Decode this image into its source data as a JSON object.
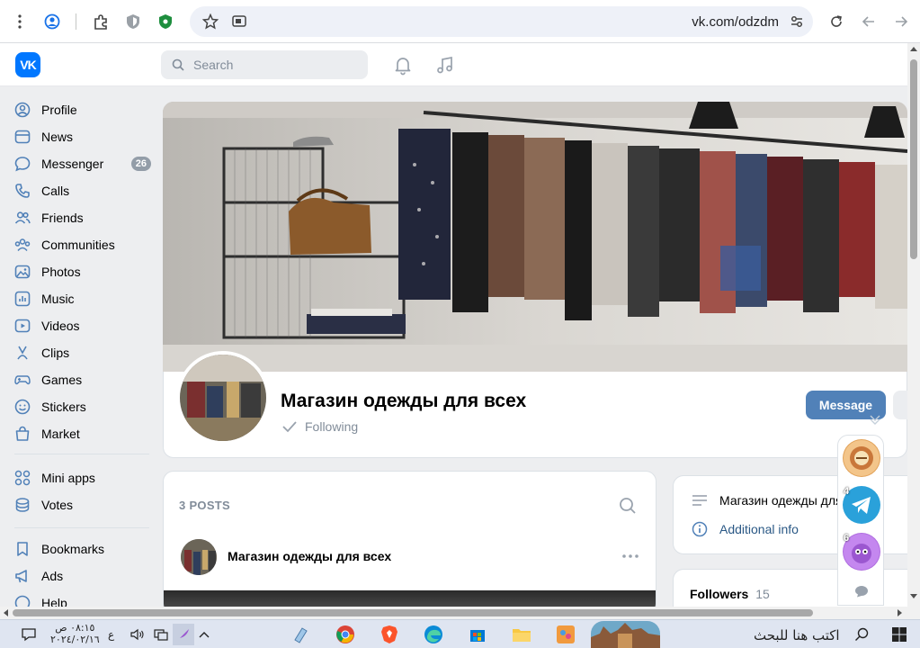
{
  "browser": {
    "url": "vk.com/odzdm"
  },
  "header": {
    "logo_text": "VK",
    "search_placeholder": "Search"
  },
  "sidebar": {
    "items": [
      {
        "label": "Profile",
        "icon": "user-circle-icon"
      },
      {
        "label": "News",
        "icon": "news-icon"
      },
      {
        "label": "Messenger",
        "icon": "chat-bubble-icon",
        "badge": "26"
      },
      {
        "label": "Calls",
        "icon": "phone-icon"
      },
      {
        "label": "Friends",
        "icon": "friends-icon"
      },
      {
        "label": "Communities",
        "icon": "communities-icon"
      },
      {
        "label": "Photos",
        "icon": "photo-icon"
      },
      {
        "label": "Music",
        "icon": "music-icon"
      },
      {
        "label": "Videos",
        "icon": "video-icon"
      },
      {
        "label": "Clips",
        "icon": "clips-icon"
      },
      {
        "label": "Games",
        "icon": "gamepad-icon"
      },
      {
        "label": "Stickers",
        "icon": "smile-icon"
      },
      {
        "label": "Market",
        "icon": "bag-icon"
      },
      {
        "label": "Mini apps",
        "icon": "grid-icon"
      },
      {
        "label": "Votes",
        "icon": "coins-icon"
      },
      {
        "label": "Bookmarks",
        "icon": "bookmark-icon"
      },
      {
        "label": "Ads",
        "icon": "megaphone-icon"
      },
      {
        "label": "Help",
        "icon": "help-icon"
      }
    ]
  },
  "group": {
    "name": "Магазин одежды для всех",
    "following_label": "Following",
    "message_button": "Message"
  },
  "posts": {
    "header": "3 POSTS",
    "author": "Магазин одежды для всех"
  },
  "info": {
    "description": "Магазин одежды для",
    "additional_label": "Additional info"
  },
  "followers": {
    "label": "Followers",
    "count": "15"
  },
  "quick_chats": [
    {
      "count": "",
      "name": "chat-badge-1"
    },
    {
      "count": "4",
      "name": "chat-telegram"
    },
    {
      "count": "6",
      "name": "chat-sticker"
    }
  ],
  "taskbar": {
    "search_text": "اكتب هنا للبحث",
    "time": "٠٨:١٥ ص",
    "date": "٢٠٢٤/٠٢/١٦",
    "lang": "ع"
  },
  "colors": {
    "vk_blue": "#0077ff",
    "button_blue": "#5181b8",
    "page_bg": "#edeef0"
  }
}
